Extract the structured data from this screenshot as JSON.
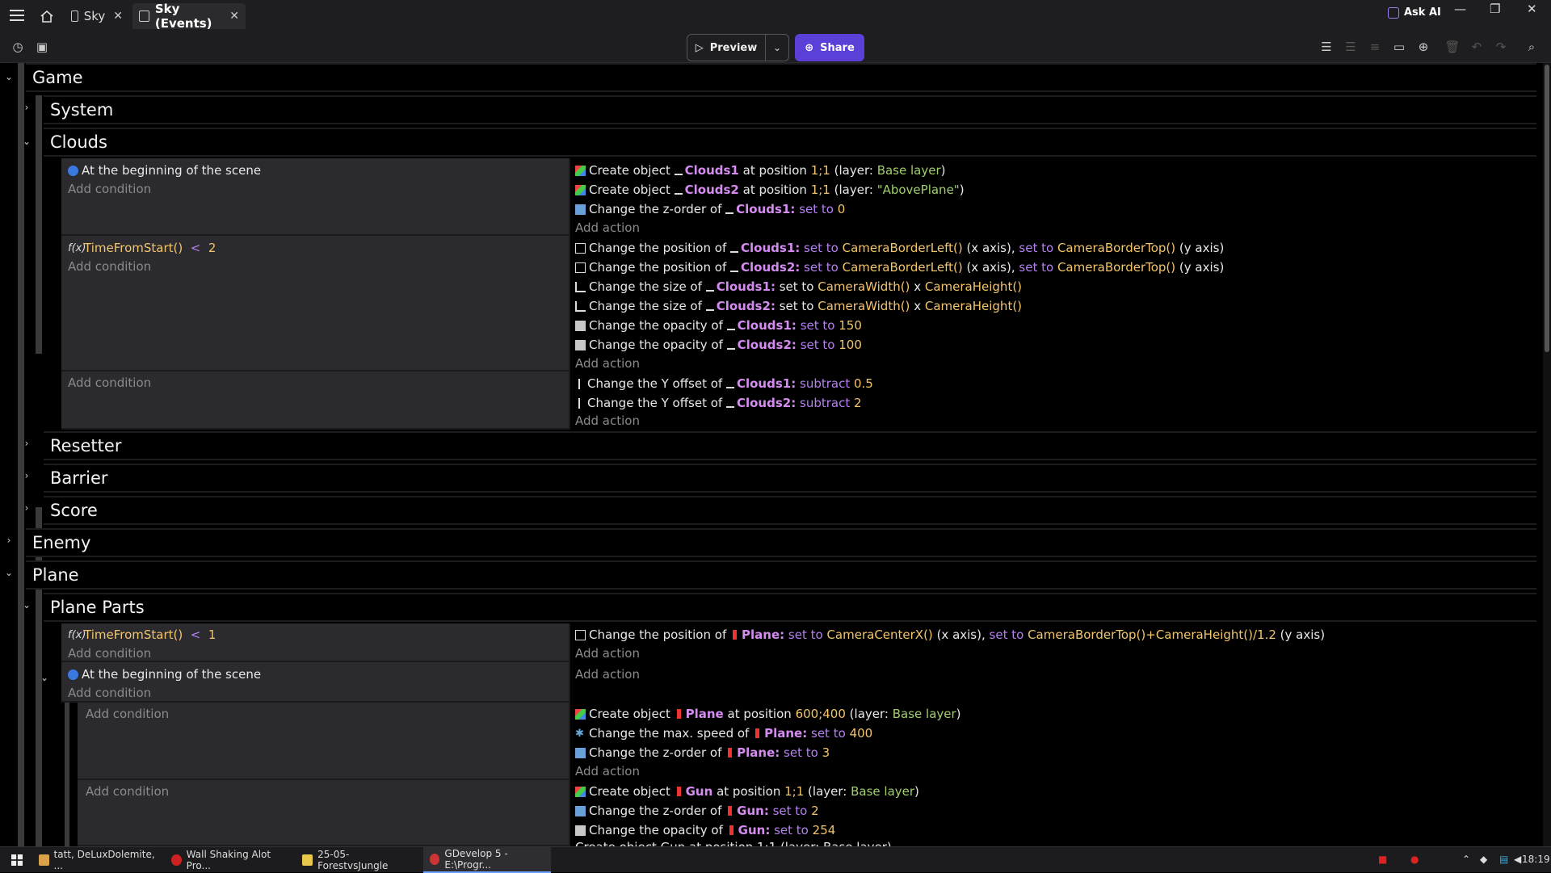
{
  "tabs": [
    {
      "label": "Sky"
    },
    {
      "label": "Sky (Events)"
    }
  ],
  "ask_ai": "Ask AI",
  "toolbar": {
    "preview": "Preview",
    "share": "Share"
  },
  "groups": {
    "game": "Game",
    "system": "System",
    "clouds": "Clouds",
    "resetter": "Resetter",
    "barrier": "Barrier",
    "score": "Score",
    "enemy": "Enemy",
    "plane": "Plane",
    "plane_parts": "Plane Parts"
  },
  "add_condition": "Add condition",
  "add_action": "Add action",
  "conditions": {
    "begin_scene": "At the beginning of the scene",
    "tfs_lt": "TimeFromStart()",
    "lt": "<",
    "two": "2",
    "one": "1"
  },
  "actions": {
    "create_object": "Create object",
    "at_position": "at position",
    "pos_11": "1;1",
    "pos_600": "600;400",
    "layer_open": "(layer:",
    "base_layer": "Base layer",
    "above_plane": "\"AbovePlane\"",
    "close": ")",
    "change_z": "Change the z-order of",
    "change_pos": "Change the position of",
    "change_size": "Change the size of",
    "change_opacity": "Change the opacity of",
    "change_yoff": "Change the Y offset of",
    "change_speed": "Change the max. speed of",
    "set_to": "set to",
    "subtract": "subtract",
    "clouds1": "Clouds1",
    "clouds2": "Clouds2",
    "plane": "Plane",
    "gun": "Gun",
    "colon": ":",
    "cbl": "CameraBorderLeft()",
    "cbt": "CameraBorderTop()",
    "x_axis": "(x axis),",
    "y_axis": "(y axis)",
    "cw": "CameraWidth()",
    "x": "x",
    "ch": "CameraHeight()",
    "ccx": "CameraCenterX()",
    "cbt_expr": "CameraBorderTop()+CameraHeight()/1.2",
    "v0": "0",
    "v2": "2",
    "v3": "3",
    "v05": "0.5",
    "v100": "100",
    "v150": "150",
    "v254": "254",
    "v400": "400",
    "partial": "Create object  Gun  at position  1;1  (layer: Base layer)"
  },
  "taskbar": [
    {
      "label": "tatt, DeLuxDolemite, ..."
    },
    {
      "label": "Wall Shaking Alot Pro..."
    },
    {
      "label": "25-05-ForestvsJungle"
    },
    {
      "label": "GDevelop 5 - E:\\Progr..."
    }
  ],
  "clock": "18:19"
}
